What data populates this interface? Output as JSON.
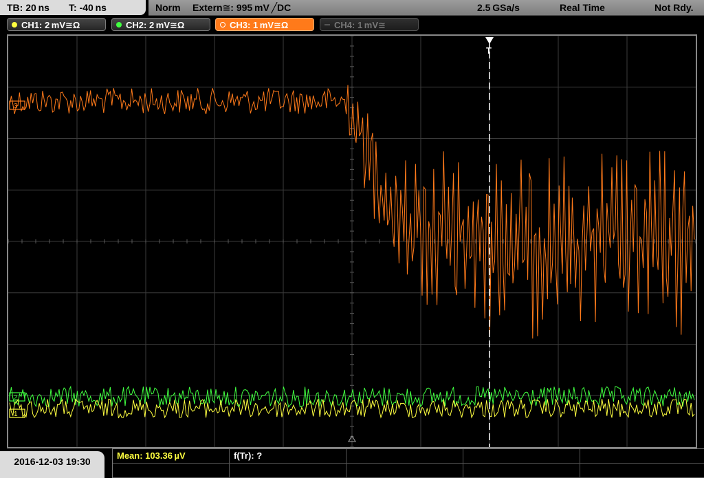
{
  "header": {
    "timebase": "TB: 20 ns",
    "trigger_time": "T: -40 ns",
    "mode": "Norm",
    "trigger_source": "Extern≅: 995 mV ╱DC",
    "sample_rate": "2.5 GSa/s",
    "acquisition": "Real Time",
    "state": "Not Rdy."
  },
  "channels": [
    {
      "label": "CH1: 2 mV≅Ω",
      "color": "#ffff40",
      "state": "on"
    },
    {
      "label": "CH2: 2 mV≅Ω",
      "color": "#40ff40",
      "state": "on"
    },
    {
      "label": "CH3: 1 mV≅Ω",
      "color": "#ff7a1a",
      "state": "selected"
    },
    {
      "label": "CH4: 1 mV≅",
      "color": "#666666",
      "state": "off"
    }
  ],
  "markers": {
    "trigger": "T",
    "ch1": "1",
    "ch2": "2",
    "ch3": "3"
  },
  "measurements": {
    "mean": "Mean: 103.36 µV",
    "rise_time": "f(Tr): ?"
  },
  "footer": {
    "datetime": "2016-12-03 19:30"
  },
  "colors": {
    "ch1": "#ffff40",
    "ch2": "#40ff40",
    "ch3": "#ff7a1a",
    "grid": "#4a4a4a",
    "trigger_line": "#ffffff"
  }
}
